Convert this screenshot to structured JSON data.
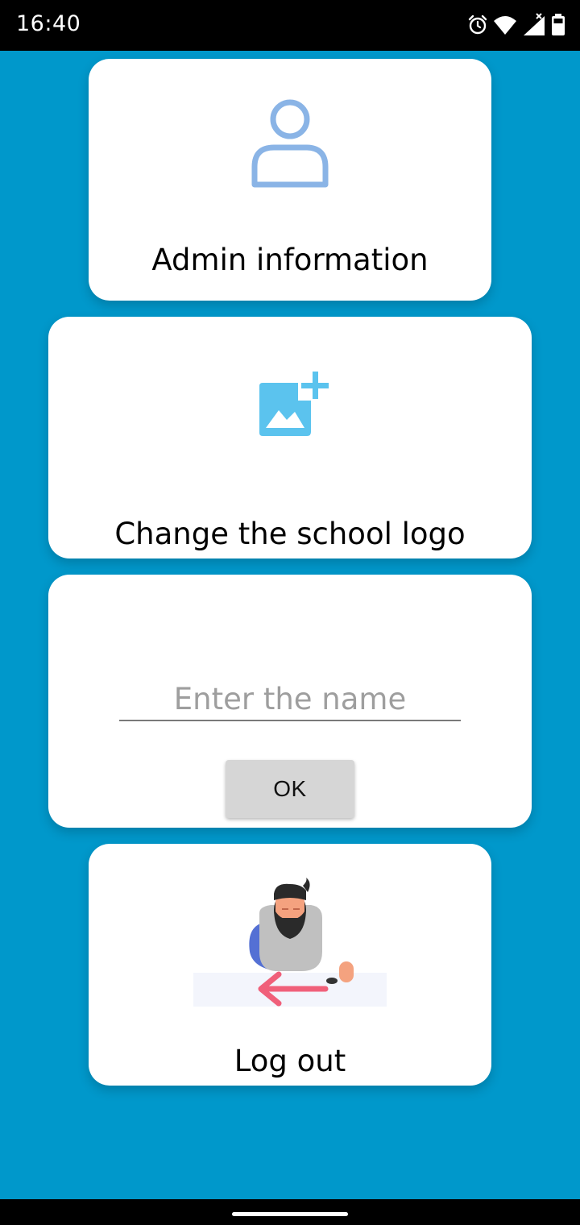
{
  "status_bar": {
    "time": "16:40",
    "icons": [
      "alarm-icon",
      "wifi-icon",
      "signal-icon",
      "battery-icon"
    ]
  },
  "cards": {
    "admin": {
      "label": "Admin information",
      "icon": "person-icon"
    },
    "logo": {
      "label": "Change the school logo",
      "icon": "add-image-icon"
    },
    "name": {
      "placeholder": "Enter the name",
      "value": "",
      "button_label": "OK"
    },
    "logout": {
      "label": "Log out",
      "icon": "logout-illustration"
    }
  },
  "colors": {
    "background": "#0098cb",
    "card": "#ffffff",
    "person_icon": "#8ab4e6",
    "image_icon": "#5bc3ee",
    "button": "#d6d6d6",
    "logout_arrow": "#f0607a"
  }
}
